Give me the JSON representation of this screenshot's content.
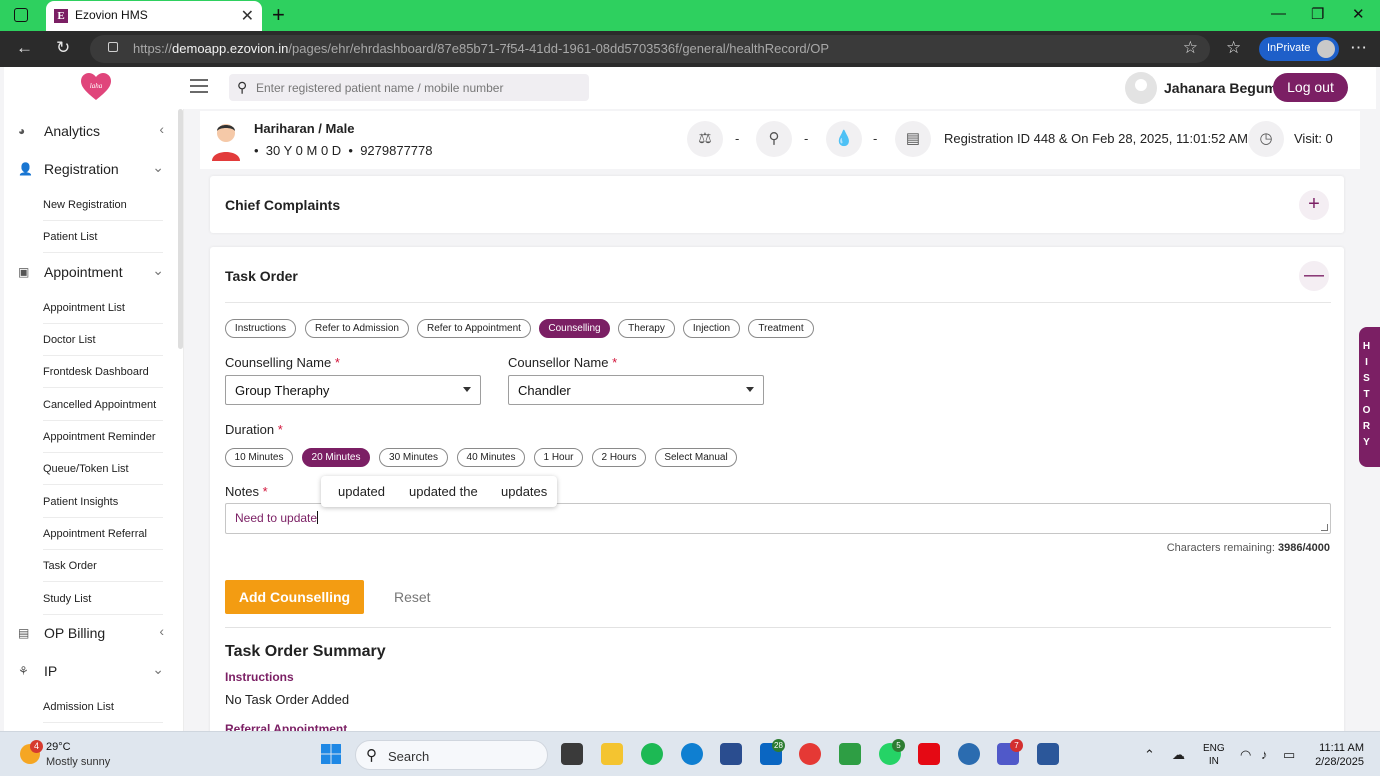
{
  "browser": {
    "tab_title": "Ezovion HMS",
    "tab_favicon_letter": "E",
    "url_prefix": "https://",
    "url_host": "demoapp.ezovion.in",
    "url_path": "/pages/ehr/ehrdashboard/87e85b71-7f54-41dd-1961-08dd5703536f/general/healthRecord/OP",
    "inprivate_label": "InPrivate"
  },
  "header": {
    "logo_text": "laha",
    "search_placeholder": "Enter registered patient name / mobile number",
    "user_name": "Jahanara Begum",
    "logout_label": "Log out"
  },
  "sidebar": {
    "groups": [
      {
        "label": "Analytics",
        "icon": "pie-chart-icon",
        "chevron": "left"
      },
      {
        "label": "Registration",
        "icon": "user-add-icon",
        "chevron": "down"
      },
      {
        "label": "Appointment",
        "icon": "calendar-icon",
        "chevron": "down"
      },
      {
        "label": "OP Billing",
        "icon": "money-icon",
        "chevron": "left"
      },
      {
        "label": "IP",
        "icon": "walking-icon",
        "chevron": "down"
      }
    ],
    "registration_items": [
      "New Registration",
      "Patient List"
    ],
    "appointment_items": [
      "Appointment List",
      "Doctor List",
      "Frontdesk Dashboard",
      "Cancelled Appointment",
      "Appointment Reminder",
      "Queue/Token List",
      "Patient Insights",
      "Appointment Referral",
      "Task Order",
      "Study List"
    ],
    "ip_items": [
      "Admission List"
    ]
  },
  "patient": {
    "name": "Hariharan / Male",
    "age": "30 Y 0 M 0 D",
    "phone": "9279877778",
    "vital_dash": "-",
    "registration": "Registration ID 448 & On Feb 28, 2025, 11:01:52 AM",
    "visit": "Visit: 0"
  },
  "chief_complaints": {
    "title": "Chief Complaints",
    "toggle": "+"
  },
  "task_order": {
    "title": "Task Order",
    "toggle": "—",
    "tabs": [
      "Instructions",
      "Refer to Admission",
      "Refer to Appointment",
      "Counselling",
      "Therapy",
      "Injection",
      "Treatment"
    ],
    "active_tab": "Counselling",
    "counselling_name_label": "Counselling Name",
    "counselling_name_value": "Group Theraphy",
    "counsellor_name_label": "Counsellor Name",
    "counsellor_name_value": "Chandler",
    "required_mark": "*",
    "duration_label": "Duration",
    "durations": [
      "10 Minutes",
      "20 Minutes",
      "30 Minutes",
      "40 Minutes",
      "1 Hour",
      "2 Hours",
      "Select Manual"
    ],
    "active_duration": "20 Minutes",
    "notes_label": "Notes",
    "notes_value": "Need to update",
    "suggestions": [
      "updated",
      "updated the",
      "updates"
    ],
    "chars_label": "Characters remaining:",
    "chars_value": "3986/4000",
    "add_label": "Add Counselling",
    "reset_label": "Reset",
    "summary_title": "Task Order Summary",
    "summary_instructions_heading": "Instructions",
    "summary_instructions_value": "No Task Order Added",
    "summary_next_heading": "Referral Appointment"
  },
  "history_tab": [
    "H",
    "I",
    "S",
    "T",
    "O",
    "R",
    "Y"
  ],
  "taskbar": {
    "temp": "29°C",
    "condition": "Mostly sunny",
    "weather_badge": "4",
    "search_label": "Search",
    "badges": {
      "linkedin": "28",
      "whatsapp": "5",
      "teams": "7"
    },
    "lang_top": "ENG",
    "lang_bottom": "IN",
    "time": "11:11 AM",
    "date": "2/28/2025"
  },
  "colors": {
    "brand": "#7b1f64",
    "accent": "#f39c12",
    "tabbar": "#2ed05f",
    "required": "#d2143a"
  }
}
